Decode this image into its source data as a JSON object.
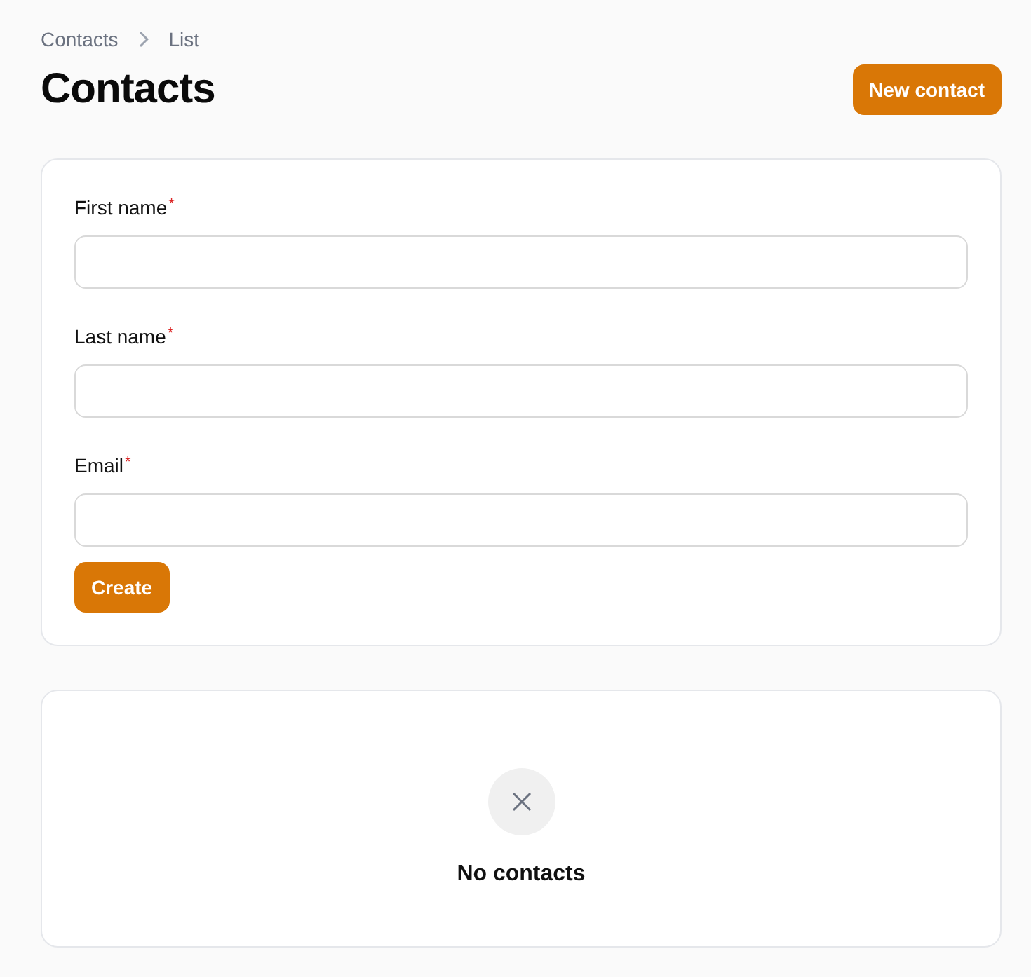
{
  "breadcrumbs": [
    {
      "label": "Contacts"
    },
    {
      "label": "List"
    }
  ],
  "title": "Contacts",
  "header_button": "New contact",
  "form": {
    "fields": [
      {
        "label": "First name",
        "required_mark": "*"
      },
      {
        "label": "Last name",
        "required_mark": "*"
      },
      {
        "label": "Email",
        "required_mark": "*"
      }
    ],
    "submit": "Create"
  },
  "empty_state": {
    "message": "No contacts"
  }
}
